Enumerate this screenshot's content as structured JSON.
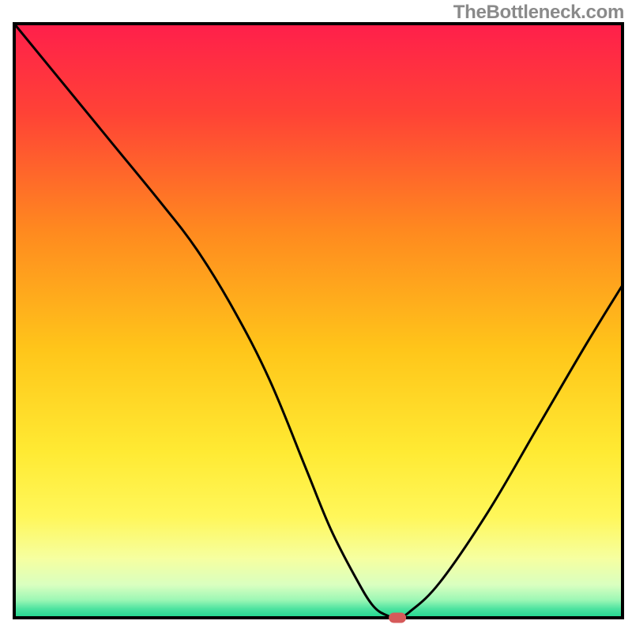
{
  "watermark": "TheBottleneck.com",
  "chart_data": {
    "type": "line",
    "title": "",
    "xlabel": "",
    "ylabel": "",
    "xlim": [
      0,
      100
    ],
    "ylim": [
      0,
      100
    ],
    "grid": false,
    "legend": false,
    "description": "Bottleneck curve over a vertical color gradient from red (top, high bottleneck) through orange/yellow to green (bottom, low bottleneck). Curve descends from top-left to a minimum near x≈63 then rises toward the right.",
    "background_gradient_stops": [
      {
        "offset": 0.0,
        "color": "#ff1f4b"
      },
      {
        "offset": 0.15,
        "color": "#ff4236"
      },
      {
        "offset": 0.35,
        "color": "#ff8a1f"
      },
      {
        "offset": 0.55,
        "color": "#ffc61a"
      },
      {
        "offset": 0.72,
        "color": "#ffea33"
      },
      {
        "offset": 0.83,
        "color": "#fff75a"
      },
      {
        "offset": 0.9,
        "color": "#f6ffa0"
      },
      {
        "offset": 0.945,
        "color": "#d9ffc0"
      },
      {
        "offset": 0.97,
        "color": "#9cf7b5"
      },
      {
        "offset": 0.985,
        "color": "#4de3a0"
      },
      {
        "offset": 1.0,
        "color": "#1fd68f"
      }
    ],
    "series": [
      {
        "name": "bottleneck-curve",
        "color": "#000000",
        "x": [
          0,
          8,
          16,
          24,
          30,
          36,
          42,
          48,
          52,
          56,
          59,
          61.5,
          63,
          65,
          70,
          78,
          86,
          94,
          100
        ],
        "y": [
          100,
          90,
          80,
          70,
          62,
          52,
          40,
          25,
          15,
          7,
          2,
          0.3,
          0,
          1,
          6,
          18,
          32,
          46,
          56
        ]
      }
    ],
    "marker": {
      "name": "optimal-point",
      "x": 63,
      "y": 0,
      "color": "#d65a5a",
      "shape": "pill"
    }
  }
}
